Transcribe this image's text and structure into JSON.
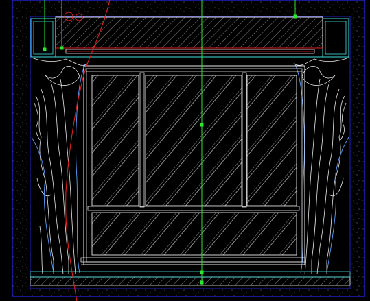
{
  "drawing": {
    "background": "#000000",
    "colors": {
      "frame_blue": "#2020c8",
      "cyan": "#40e0e0",
      "white": "#e8e8e8",
      "green": "#2ee62e",
      "red": "#e02020",
      "light_blue": "#5aa0ff",
      "hatch": "#c8c8c8",
      "speckle": "#5a5a5a"
    },
    "elements": {
      "frame": "outer-wall-frame",
      "pelmet": "curtain-pelmet-box",
      "left_column": "left-wall-column",
      "right_column": "right-wall-column",
      "window": "window-with-glazed-panes",
      "left_curtain": "left-drape",
      "right_curtain": "right-drape",
      "baseboard": "floor-baseboard",
      "axis_line": "center-axis-line",
      "cut_line": "section-cut-line"
    }
  }
}
